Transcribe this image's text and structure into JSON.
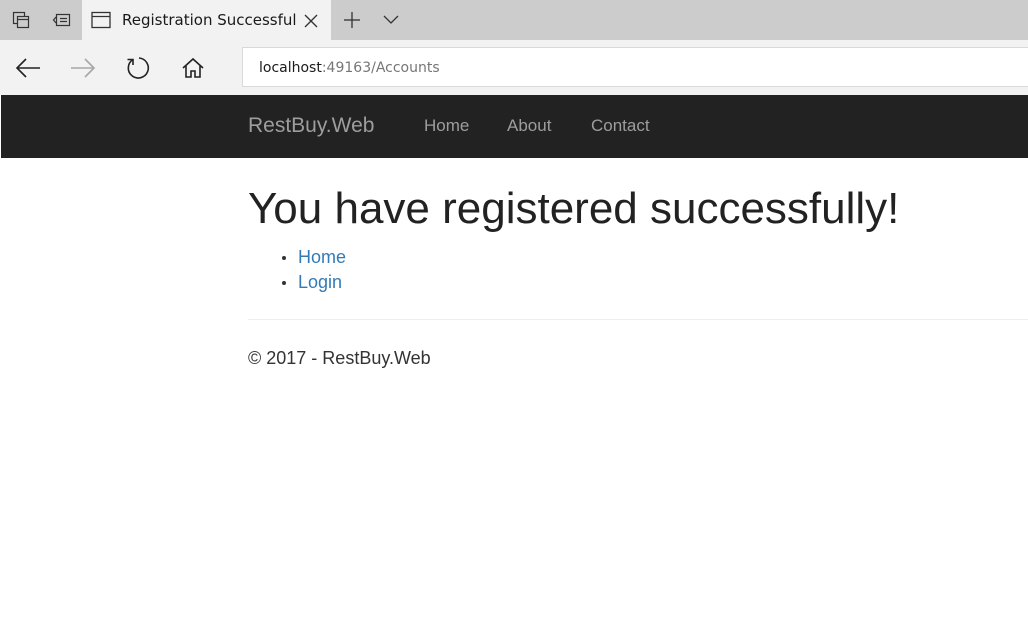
{
  "browser": {
    "tab": {
      "title": "Registration Successful"
    },
    "address": {
      "host": "localhost",
      "rest": ":49163/Accounts"
    },
    "icons": {
      "tab_manager": "tab-manager-icon",
      "set_aside": "set-tabs-aside-icon",
      "tab_page": "page-icon",
      "close": "close-icon",
      "new_tab": "plus-icon",
      "tab_list": "chevron-down-icon",
      "back": "back-arrow-icon",
      "forward": "forward-arrow-icon",
      "refresh": "refresh-icon",
      "home": "home-icon"
    }
  },
  "site": {
    "brand": "RestBuy.Web",
    "nav": [
      {
        "label": "Home"
      },
      {
        "label": "About"
      },
      {
        "label": "Contact"
      }
    ]
  },
  "content": {
    "heading": "You have registered successfully!",
    "links": [
      {
        "label": "Home"
      },
      {
        "label": "Login"
      }
    ]
  },
  "footer": {
    "text": "© 2017 - RestBuy.Web"
  },
  "colors": {
    "tab_strip": "#cccccc",
    "toolbar": "#f2f2f2",
    "navbar": "#222222",
    "navbar_text": "#9d9d9d",
    "link": "#337ab7",
    "heading": "#222222"
  }
}
